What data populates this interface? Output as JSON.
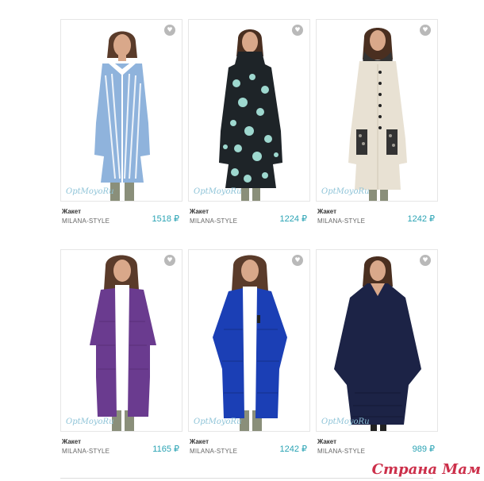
{
  "products": [
    {
      "name": "Жакет",
      "brand": "MILANA-STYLE",
      "price": "1518 ₽",
      "logo": "OptMoyoRu",
      "coat": "#8fb3dc",
      "accent": "#ffffff",
      "skin": "#d9a88a",
      "hair": "#5a3b2a",
      "pattern": "stripes",
      "legs": "#8a8f7a"
    },
    {
      "name": "Жакет",
      "brand": "MILANA-STYLE",
      "price": "1224 ₽",
      "logo": "OptMoyoRu",
      "coat": "#1e2428",
      "accent": "#9ed8cf",
      "skin": "#d9a88a",
      "hair": "#4a2f20",
      "pattern": "floral",
      "legs": "#8a8f7a"
    },
    {
      "name": "Жакет",
      "brand": "MILANA-STYLE",
      "price": "1242 ₽",
      "logo": "OptMoyoRu",
      "coat": "#e8e1d3",
      "accent": "#222222",
      "skin": "#d9a88a",
      "hair": "#4a2f20",
      "pattern": "cable",
      "legs": "#8a8f7a"
    },
    {
      "name": "Жакет",
      "brand": "MILANA-STYLE",
      "price": "1165 ₽",
      "logo": "OptMoyoRu",
      "coat": "#6a3b8f",
      "accent": "#ffffff",
      "skin": "#d9a88a",
      "hair": "#5a3b2a",
      "pattern": "plain",
      "legs": "#8a8f7a"
    },
    {
      "name": "Жакет",
      "brand": "MILANA-STYLE",
      "price": "1242 ₽",
      "logo": "OptMoyoRu",
      "coat": "#1b3fb5",
      "accent": "#ffffff",
      "skin": "#d9a88a",
      "hair": "#5a3b2a",
      "pattern": "plain",
      "legs": "#8a8f7a"
    },
    {
      "name": "Жакет",
      "brand": "MILANA-STYLE",
      "price": "989 ₽",
      "logo": "OptMoyoRu",
      "coat": "#1c2346",
      "accent": "#1c2346",
      "skin": "#d9a88a",
      "hair": "#4a2f20",
      "pattern": "poncho",
      "legs": "#222222"
    }
  ],
  "watermark": "Страна Мам",
  "icons": {
    "favorite": "heart-icon"
  },
  "colors": {
    "price": "#2aa3b4",
    "watermark": "#cc2f4a"
  }
}
